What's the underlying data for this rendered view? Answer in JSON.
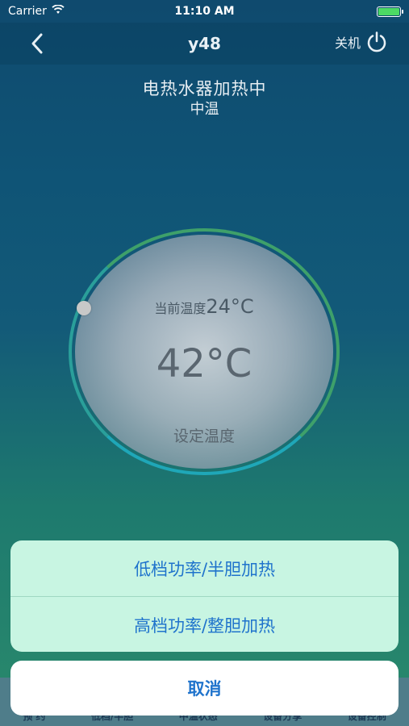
{
  "status_bar": {
    "carrier": "Carrier",
    "time": "11:10 AM"
  },
  "nav": {
    "title": "y48",
    "power_label": "关机"
  },
  "heater": {
    "state": "电热水器加热中",
    "mode": "中温"
  },
  "dial": {
    "current_label": "当前温度",
    "current_value": "24°C",
    "set_value": "42°C",
    "set_label": "设定温度"
  },
  "bottom_tabs": [
    "预 约",
    "低档/半胆",
    "中温状态",
    "设备分享",
    "设备控制"
  ],
  "action_sheet": {
    "options": [
      "低档功率/半胆加热",
      "高档功率/整胆加热"
    ],
    "cancel": "取消"
  },
  "colors": {
    "action_text": "#1f73cc",
    "sheet_bg": "#c8f5e2",
    "battery": "#4cd964"
  }
}
